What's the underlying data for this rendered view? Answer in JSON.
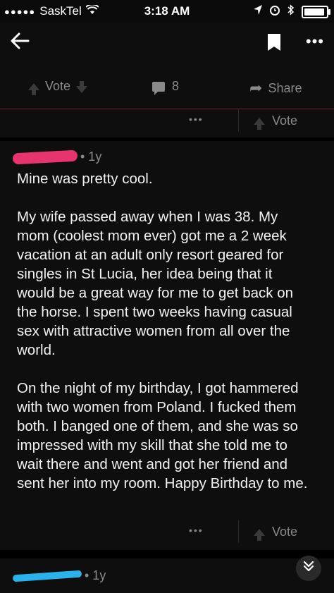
{
  "status_bar": {
    "signal_dots": "●●●●●",
    "carrier": "SaskTel",
    "time": "3:18 AM",
    "icons": [
      "location-icon",
      "alarm-icon",
      "bluetooth-icon",
      "battery-icon"
    ]
  },
  "nav": {
    "back_icon": "arrow-left-icon",
    "bookmark_icon": "bookmark-icon",
    "more_icon": "more-icon"
  },
  "post_actions": {
    "vote_label": "Vote",
    "comments_count": "8",
    "share_label": "Share"
  },
  "comment_rows": [
    {
      "dots": "•••",
      "vote_label": "Vote"
    },
    {
      "dots": "•••",
      "vote_label": "Vote"
    }
  ],
  "comments": [
    {
      "age": "• 1y",
      "paragraphs": [
        "Mine was pretty cool.",
        "My wife passed away when I was 38.  My mom (coolest mom ever) got me a 2 week vacation at an adult only resort geared for singles in St Lucia, her idea being that it would be a great way for me to get back on the horse.  I spent two weeks having casual sex with attractive women from all over the world.",
        "On the night of my birthday, I got hammered with two women from Poland.  I fucked them both.  I banged one of them, and she was so impressed with my skill that she told me to wait there and went and got her friend and sent her into my room.  Happy Birthday to me."
      ]
    },
    {
      "age": "• 1y"
    }
  ],
  "colors": {
    "background": "#000000",
    "panel": "#0e0e0e",
    "muted_text": "#8a8a8a",
    "redaction_pink": "#e8346e",
    "redaction_blue": "#2ab2ea"
  }
}
